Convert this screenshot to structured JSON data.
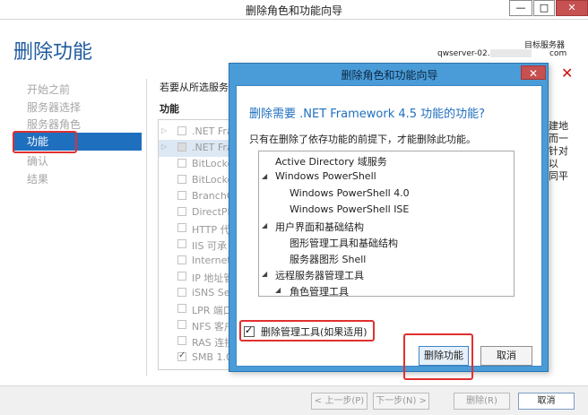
{
  "window": {
    "title": "删除角色和功能向导",
    "controls": {
      "minimize": "—",
      "maximize": "□",
      "close": "✕"
    }
  },
  "page": {
    "title": "删除功能",
    "server_label": "目标服务器",
    "server_name_prefix": "qwserver-02.",
    "server_name_suffix": "com",
    "close_glyph": "✕"
  },
  "nav": {
    "items": [
      "开始之前",
      "服务器选择",
      "服务器角色",
      "功能",
      "确认",
      "结果"
    ],
    "active_index": 3
  },
  "main": {
    "hint": "若要从所选服务器",
    "features_header": "功能",
    "features": [
      {
        "label": ".NET Fra",
        "arrow": "▷",
        "checked": false,
        "selected": false
      },
      {
        "label": ".NET Fra",
        "arrow": "▷",
        "checked": false,
        "selected": true
      },
      {
        "label": "BitLocke",
        "arrow": "",
        "checked": false,
        "selected": false
      },
      {
        "label": "BitLocke",
        "arrow": "",
        "checked": false,
        "selected": false
      },
      {
        "label": "BranchC",
        "arrow": "",
        "checked": false,
        "selected": false
      },
      {
        "label": "DirectPla",
        "arrow": "",
        "checked": false,
        "selected": false
      },
      {
        "label": "HTTP 代",
        "arrow": "",
        "checked": false,
        "selected": false
      },
      {
        "label": "IIS 可承",
        "arrow": "",
        "checked": false,
        "selected": false
      },
      {
        "label": "Internet",
        "arrow": "",
        "checked": false,
        "selected": false
      },
      {
        "label": "IP 地址管",
        "arrow": "",
        "checked": false,
        "selected": false
      },
      {
        "label": "iSNS Ser",
        "arrow": "",
        "checked": false,
        "selected": false
      },
      {
        "label": "LPR 端口",
        "arrow": "",
        "checked": false,
        "selected": false
      },
      {
        "label": "NFS 客户",
        "arrow": "",
        "checked": false,
        "selected": false
      },
      {
        "label": "RAS 连接",
        "arrow": "",
        "checked": false,
        "selected": false
      },
      {
        "label": "SMB 1.0",
        "arrow": "",
        "checked": true,
        "selected": false
      }
    ],
    "right_snippet": [
      "建地",
      "而一",
      "针对",
      "以",
      "同平"
    ]
  },
  "footer": {
    "prev": "< 上一步(P)",
    "next": "下一步(N) >",
    "remove": "删除(R)",
    "cancel": "取消"
  },
  "dialog": {
    "title": "删除角色和功能向导",
    "close_glyph": "✕",
    "heading": "删除需要 .NET Framework 4.5 功能的功能?",
    "description": "只有在删除了依存功能的前提下，才能删除此功能。",
    "tree": [
      {
        "label": "Active Directory 域服务",
        "level": 0,
        "expandable": false
      },
      {
        "label": "Windows PowerShell",
        "level": 0,
        "expandable": true
      },
      {
        "label": "Windows PowerShell 4.0",
        "level": 1,
        "expandable": false
      },
      {
        "label": "Windows PowerShell ISE",
        "level": 1,
        "expandable": false
      },
      {
        "label": "用户界面和基础结构",
        "level": 0,
        "expandable": true
      },
      {
        "label": "图形管理工具和基础结构",
        "level": 1,
        "expandable": false
      },
      {
        "label": "服务器图形 Shell",
        "level": 1,
        "expandable": false
      },
      {
        "label": "远程服务器管理工具",
        "level": 0,
        "expandable": true
      },
      {
        "label": "角色管理工具",
        "level": 1,
        "expandable": true
      }
    ],
    "include_tools_label": "删除管理工具(如果适用)",
    "include_tools_checked": true,
    "remove_button": "删除功能",
    "cancel_button": "取消"
  },
  "colors": {
    "accent": "#1f6fbf",
    "dialog_frame": "#4a9cd8",
    "close_red": "#c75050",
    "highlight_red": "#e03030"
  }
}
